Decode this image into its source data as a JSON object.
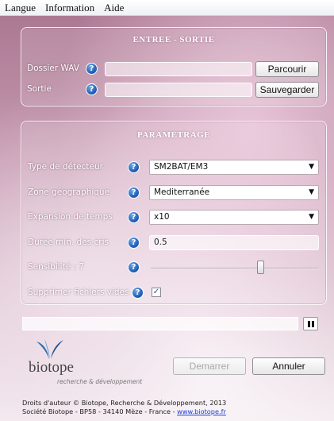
{
  "menu": {
    "items": [
      "Langue",
      "Information",
      "Aide"
    ]
  },
  "io": {
    "title": "ENTREE - SORTIE",
    "wav_label": "Dossier WAV",
    "sortie_label": "Sortie",
    "wav_value": "",
    "sortie_value": "",
    "browse_label": "Parcourir",
    "save_label": "Sauvegarder"
  },
  "params": {
    "title": "PARAMETRAGE",
    "detector_label": "Type de détecteur",
    "detector_value": "SM2BAT/EM3",
    "zone_label": "Zone géographique",
    "zone_value": "Mediterranée",
    "expansion_label": "Expansion de temps",
    "expansion_value": "x10",
    "duree_label": "Durée min. des cris",
    "duree_value": "0.5",
    "sensibilite_label": "Sensibilité : 7",
    "sensibilite_value": 7,
    "supprimer_label": "Supprimer fichiers vides",
    "supprimer_checked": true,
    "help_glyph": "?",
    "check_glyph": "✓",
    "arrow_glyph": "▼"
  },
  "progress": {
    "value": 0
  },
  "actions": {
    "start_label": "Demarrer",
    "cancel_label": "Annuler"
  },
  "logo": {
    "text": "biotope",
    "subtitle": "recherche & développement"
  },
  "footer": {
    "line1": "Droits d'auteur © Biotope, Recherche & Développement, 2013",
    "line2": "Société Biotope - BP58 - 34140 Mèze - France - ",
    "link": "www.biotope.fr"
  },
  "colors": {
    "help_blue": "#1b58b0",
    "link_blue": "#1a3fd6"
  }
}
